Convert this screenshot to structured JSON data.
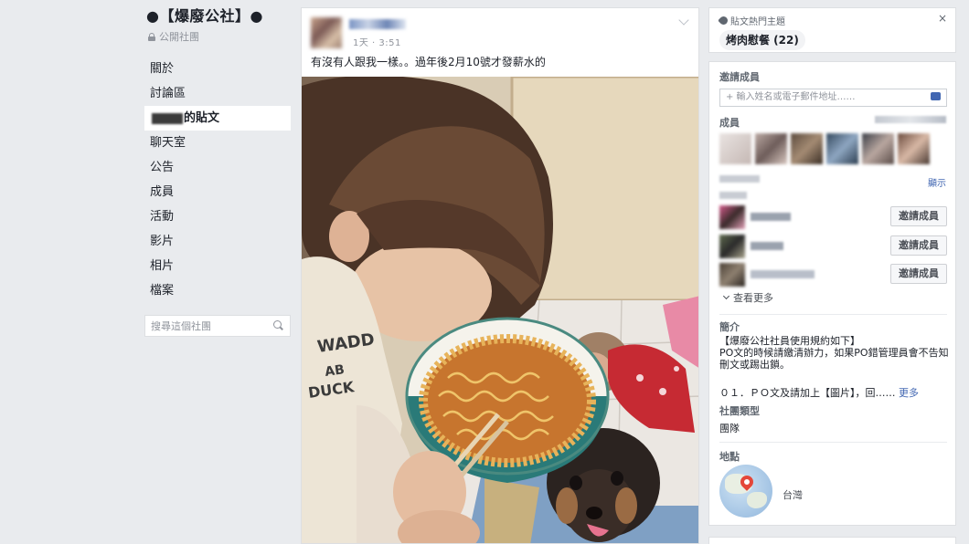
{
  "group": {
    "title": "●【爆廢公社】●",
    "privacy": "公開社團"
  },
  "nav": {
    "items": [
      {
        "label": "關於"
      },
      {
        "label": "討論區"
      },
      {
        "label": "的貼文",
        "active": true
      },
      {
        "label": "聊天室"
      },
      {
        "label": "公告"
      },
      {
        "label": "成員"
      },
      {
        "label": "活動"
      },
      {
        "label": "影片"
      },
      {
        "label": "相片"
      },
      {
        "label": "檔案"
      }
    ],
    "search_placeholder": "搜尋這個社團"
  },
  "post": {
    "time": "1天 · 3:51",
    "text": "有沒有人跟我一樣。。過年後2月10號才發薪水的"
  },
  "side": {
    "tags_title": "貼文熱門主題",
    "tag_pill": "烤肉慰餐 (22)",
    "close_label": "×",
    "invite_title": "邀請成員",
    "invite_placeholder": "+ 輸入姓名或電子郵件地址……",
    "members_title": "成員",
    "see_all": "顯示",
    "invite_button_label": "邀請成員",
    "see_more": "查看更多",
    "intro_title": "簡介",
    "intro_text": "【爆廢公社社員使用規約如下】\nPO文的時候請繳清辦力，如果PO錯管理員會不告知刪文或踢出鎖。",
    "intro_more_text": "０１．ＰＯ文及請加上【圖片】，回……",
    "intro_more_link": "更多",
    "type_title": "社團類型",
    "type_value": "團隊",
    "location_title": "地點",
    "location_value": "台灣"
  },
  "colors": {
    "background": "#e9ebee",
    "link": "#4267b2",
    "pin": "#e4473a"
  }
}
